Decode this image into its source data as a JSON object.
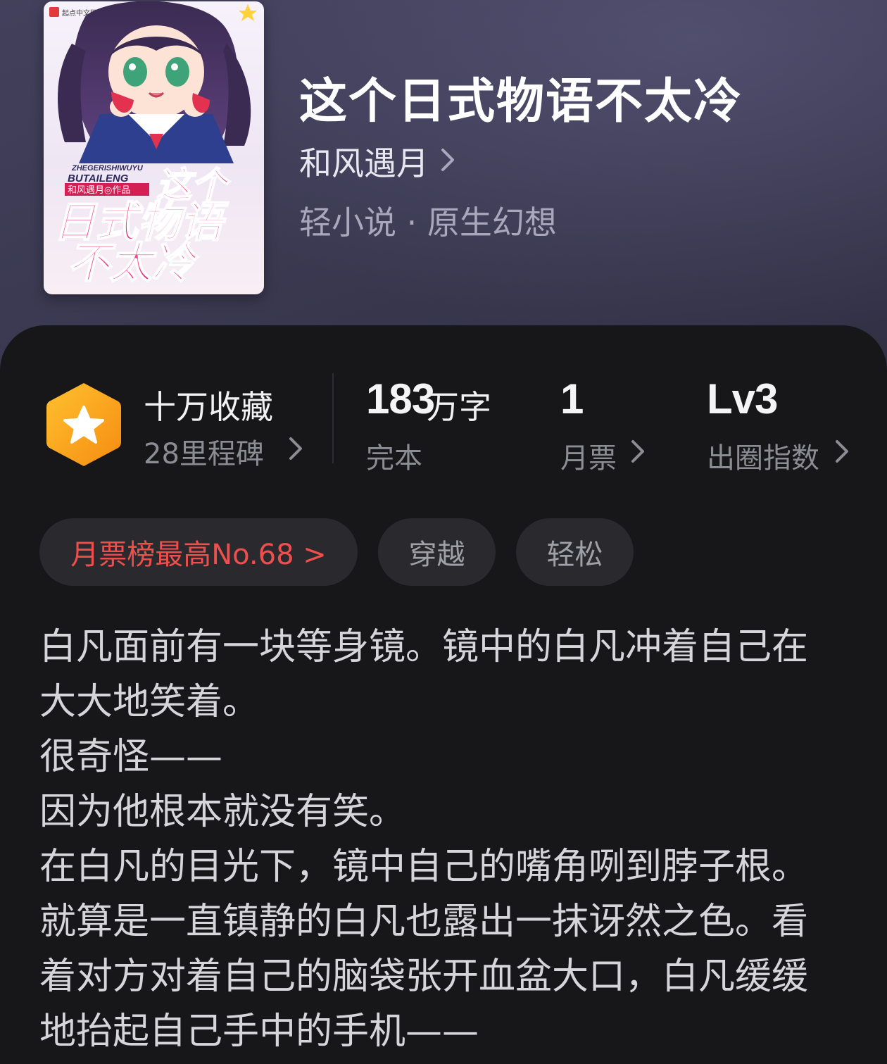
{
  "book": {
    "title": "这个日式物语不太冷",
    "author": "和风遇月",
    "category": "轻小说 · 原生幻想"
  },
  "cover": {
    "publisher": "起点中文网",
    "pinyin_line1": "ZHEGERISHIWUYU",
    "pinyin_line2": "BUTAILENG",
    "byline": "和风遇月◎作品",
    "title_line1": "这个",
    "title_line2": "日式物语",
    "title_line3": "不太冷"
  },
  "stats": {
    "collection_title": "十万收藏",
    "collection_sub": "28里程碑",
    "word_count_number": "183",
    "word_count_unit": "万字",
    "status": "完本",
    "monthly_ticket_number": "1",
    "monthly_ticket_label": "月票",
    "popularity_level": "Lv3",
    "popularity_label": "出圈指数"
  },
  "tags": {
    "rank": "月票榜最高No.68 >",
    "tag1": "穿越",
    "tag2": "轻松"
  },
  "synopsis": [
    "白凡面前有一块等身镜。镜中的白凡冲着自己在",
    "大大地笑着。",
    "很奇怪——",
    "因为他根本就没有笑。",
    "在白凡的目光下，镜中自己的嘴角咧到脖子根。",
    "就算是一直镇静的白凡也露出一抹讶然之色。看",
    "着对方对着自己的脑袋张开血盆大口，白凡缓缓",
    "地抬起自己手中的手机——"
  ],
  "colors": {
    "header_bg": "#3b3a52",
    "sheet_bg": "#171719",
    "accent_red": "#ef4f4c",
    "badge_orange": "#f7a21b"
  }
}
